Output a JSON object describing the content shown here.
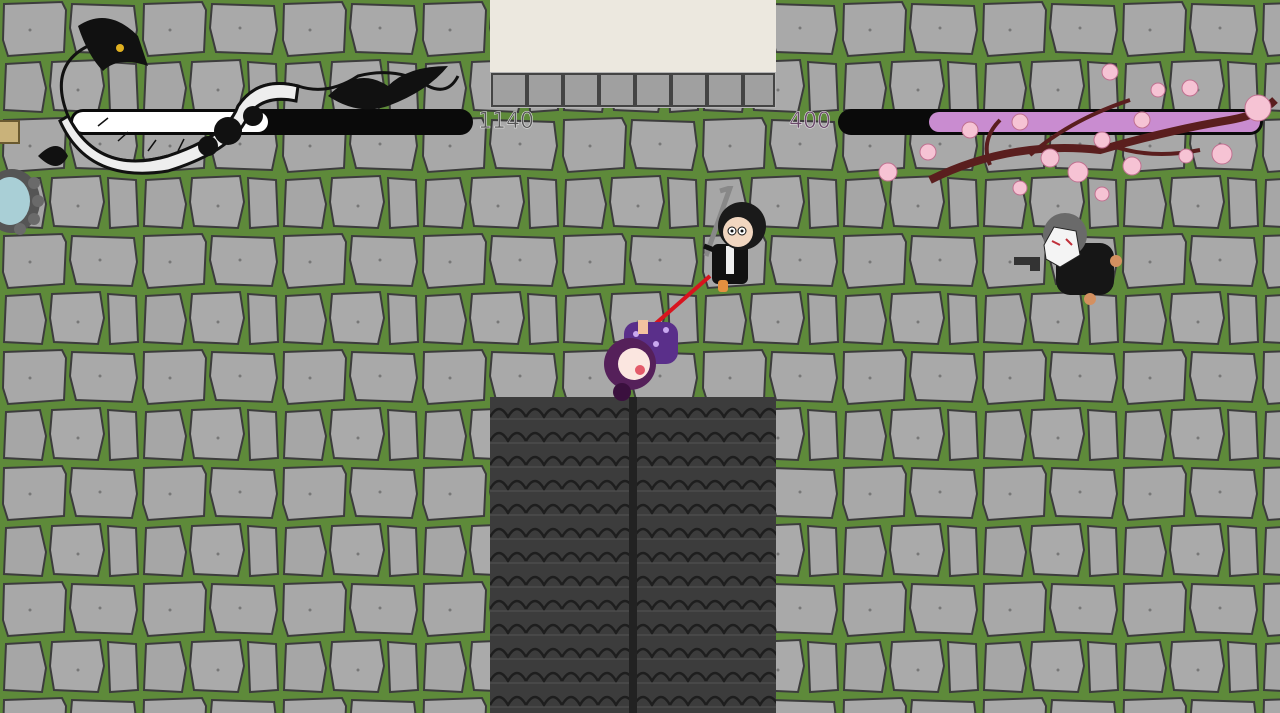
{
  "game": {
    "left_fighter": {
      "hp_value": "1140",
      "hp_fraction": 0.49,
      "emblem": "dragon-emblem"
    },
    "right_fighter": {
      "hp_value": "400",
      "hp_fraction": 0.79,
      "emblem": "cherry-blossom-emblem"
    }
  },
  "colors": {
    "stone": "#a8a8a8",
    "mortar": "#5e8a3a",
    "left_bar_fill": "#ffffff",
    "right_bar_fill": "#c98cd0",
    "roof": "#3a3a3a",
    "tether": "#d8141e"
  },
  "characters": [
    {
      "name": "swordsman-player",
      "icon": "katana-icon"
    },
    {
      "name": "purple-haired-girl",
      "icon": "chibi-girl-icon"
    },
    {
      "name": "masked-gunman",
      "icon": "pistol-icon"
    }
  ]
}
